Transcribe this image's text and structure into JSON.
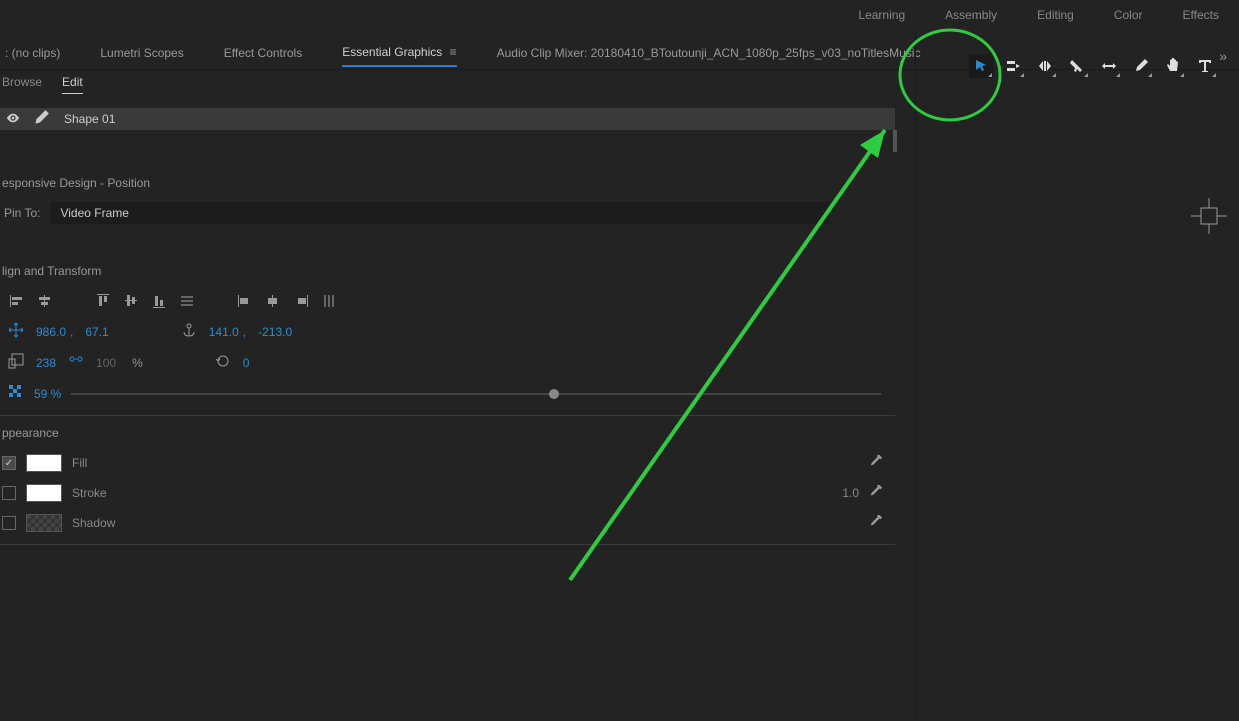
{
  "workspaces": [
    "Learning",
    "Assembly",
    "Editing",
    "Color",
    "Effects"
  ],
  "tabs": {
    "source": ": (no clips)",
    "lumetri": "Lumetri Scopes",
    "effectControls": "Effect Controls",
    "essentialGraphics": "Essential Graphics",
    "audioMixer": "Audio Clip Mixer: 20180410_BToutounji_ACN_1080p_25fps_v03_noTitlesMusic"
  },
  "subtabs": {
    "browse": "Browse",
    "edit": "Edit"
  },
  "layer": {
    "name": "Shape 01"
  },
  "responsive": {
    "header": "esponsive Design - Position",
    "pinToLabel": "Pin To:",
    "pinToValue": "Video Frame"
  },
  "align": {
    "header": "lign and Transform",
    "position": {
      "x": "986.0",
      "y": "67.1"
    },
    "anchor": {
      "x": "141.0",
      "y": "-213.0"
    },
    "scale": {
      "value": "238",
      "linked": "100",
      "unit": "%"
    },
    "rotation": "0",
    "opacity": "59 %"
  },
  "appearance": {
    "header": "ppearance",
    "fill": "Fill",
    "stroke": "Stroke",
    "strokeWidth": "1.0",
    "shadow": "Shadow"
  },
  "annotation": {
    "color": "#2ecc40"
  }
}
